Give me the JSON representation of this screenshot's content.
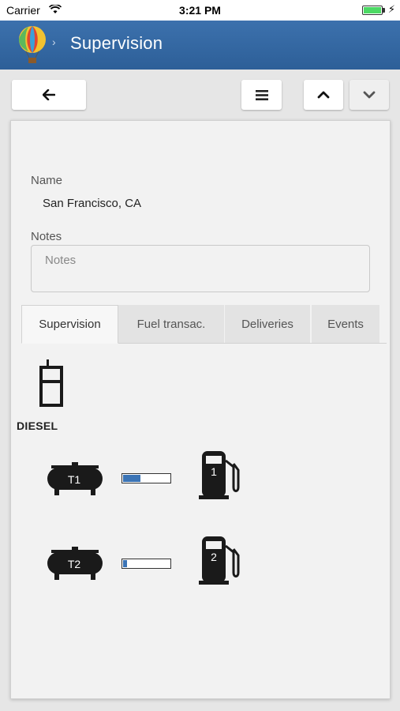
{
  "status_bar": {
    "carrier": "Carrier",
    "time": "3:21 PM"
  },
  "navbar": {
    "title": "Supervision",
    "accent": "#3568a4"
  },
  "toolbar": {
    "back_icon": "arrow-left-icon",
    "menu_icon": "hamburger-icon",
    "up_icon": "chevron-up-icon",
    "down_icon": "chevron-down-icon"
  },
  "form": {
    "name_label": "Name",
    "name_value": "San Francisco, CA",
    "notes_label": "Notes",
    "notes_placeholder": "Notes"
  },
  "tabs": [
    {
      "label": "Supervision",
      "active": true
    },
    {
      "label": "Fuel transac.",
      "active": false
    },
    {
      "label": "Deliveries",
      "active": false
    },
    {
      "label": "Events",
      "active": false
    }
  ],
  "supervision": {
    "product": "DIESEL",
    "rows": [
      {
        "tank": "T1",
        "level_fraction": 0.37,
        "pump": "1"
      },
      {
        "tank": "T2",
        "level_fraction": 0.08,
        "pump": "2"
      }
    ]
  }
}
